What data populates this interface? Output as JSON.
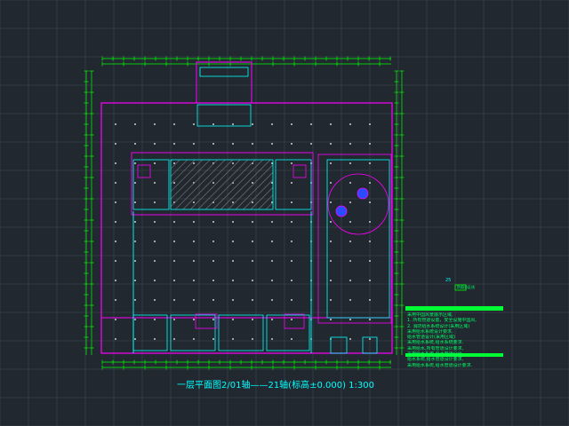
{
  "title": "一层平面图2/01轴——21轴(标高±0.000)   1:300",
  "legend": {
    "label": "25",
    "item": "防烟分区线"
  },
  "notes": [
    "采用中国风景展示区域,",
    "1. 所有管道设置，安全设施中国风,",
    "2. 消防给水系统设计(采用区域)",
    "   采用给水系统设计要求,",
    "   给水管道设计(采用区域)",
    "   采用给水系统,给水系统要求.",
    "   ",
    "采用给水,所有管道设计要求,",
    "   采用给水系统,给水管道设计,",
    "   给水系统,给水管道设计要求,",
    "   采用给水系统,给水管道设计要求."
  ],
  "colors": {
    "background": "#212830",
    "grid": "#3c4650",
    "axis": "#00ff00",
    "wall": "#ff00ff",
    "structure": "#00ffff",
    "text": "#00ff66"
  }
}
